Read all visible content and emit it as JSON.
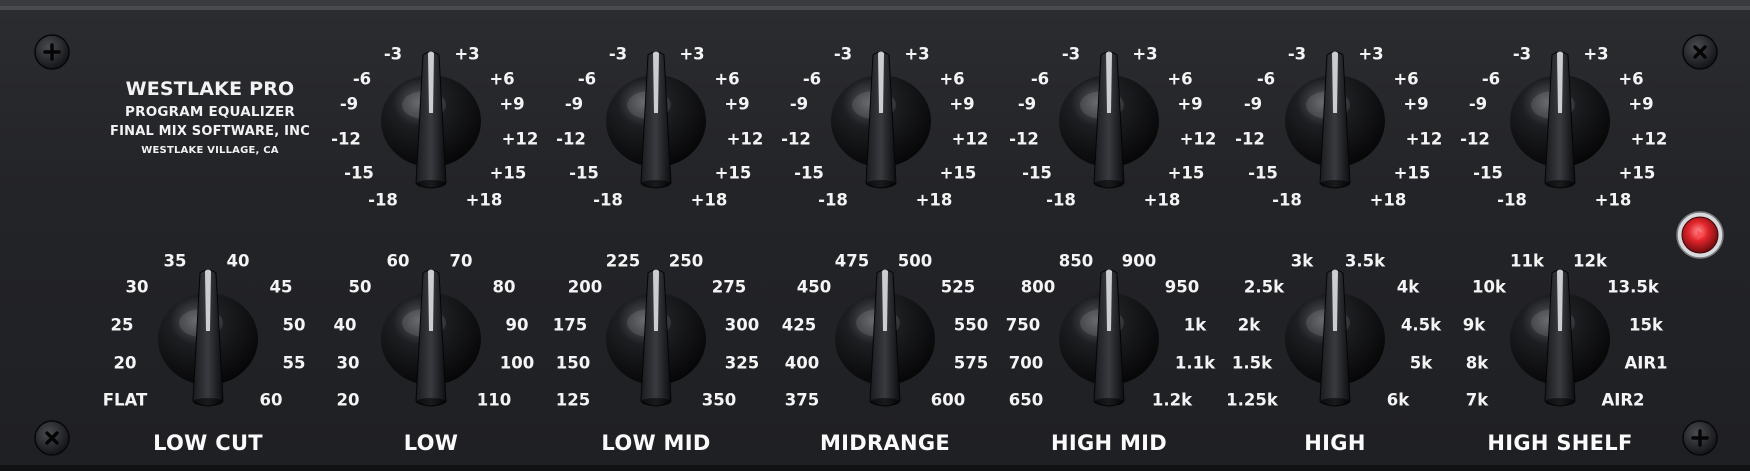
{
  "brand": {
    "line1": "WESTLAKE PRO",
    "line2": "PROGRAM EQUALIZER",
    "line3": "FINAL MIX SOFTWARE, INC",
    "line4": "WESTLAKE VILLAGE, CA"
  },
  "gain_knobs": [
    {
      "id": "gain-low-cut",
      "ticks": [
        "-18",
        "-15",
        "-12",
        "-9",
        "-6",
        "-3",
        "+3",
        "+6",
        "+9",
        "+12",
        "+15",
        "+18"
      ],
      "value": "0"
    },
    {
      "id": "gain-low",
      "ticks": [
        "-18",
        "-15",
        "-12",
        "-9",
        "-6",
        "-3",
        "+3",
        "+6",
        "+9",
        "+12",
        "+15",
        "+18"
      ],
      "value": "0"
    },
    {
      "id": "gain-low-mid",
      "ticks": [
        "-18",
        "-15",
        "-12",
        "-9",
        "-6",
        "-3",
        "+3",
        "+6",
        "+9",
        "+12",
        "+15",
        "+18"
      ],
      "value": "0"
    },
    {
      "id": "gain-midrange",
      "ticks": [
        "-18",
        "-15",
        "-12",
        "-9",
        "-6",
        "-3",
        "+3",
        "+6",
        "+9",
        "+12",
        "+15",
        "+18"
      ],
      "value": "0"
    },
    {
      "id": "gain-high-mid",
      "ticks": [
        "-18",
        "-15",
        "-12",
        "-9",
        "-6",
        "-3",
        "+3",
        "+6",
        "+9",
        "+12",
        "+15",
        "+18"
      ],
      "value": "0"
    },
    {
      "id": "gain-high",
      "ticks": [
        "-18",
        "-15",
        "-12",
        "-9",
        "-6",
        "-3",
        "+3",
        "+6",
        "+9",
        "+12",
        "+15",
        "+18"
      ],
      "value": "0"
    }
  ],
  "freq_knobs": [
    {
      "id": "freq-low-cut",
      "label": "LOW CUT",
      "ticks": [
        "FLAT",
        "20",
        "25",
        "30",
        "35",
        "40",
        "45",
        "50",
        "55",
        "60"
      ]
    },
    {
      "id": "freq-low",
      "label": "LOW",
      "ticks": [
        "20",
        "30",
        "40",
        "50",
        "60",
        "70",
        "80",
        "90",
        "100",
        "110"
      ]
    },
    {
      "id": "freq-low-mid",
      "label": "LOW MID",
      "ticks": [
        "125",
        "150",
        "175",
        "200",
        "225",
        "250",
        "275",
        "300",
        "325",
        "350"
      ]
    },
    {
      "id": "freq-midrange",
      "label": "MIDRANGE",
      "ticks": [
        "375",
        "400",
        "425",
        "450",
        "475",
        "500",
        "525",
        "550",
        "575",
        "600"
      ]
    },
    {
      "id": "freq-high-mid",
      "label": "HIGH MID",
      "ticks": [
        "650",
        "700",
        "750",
        "800",
        "850",
        "900",
        "950",
        "1k",
        "1.1k",
        "1.2k"
      ]
    },
    {
      "id": "freq-high",
      "label": "HIGH",
      "ticks": [
        "1.25k",
        "1.5k",
        "2k",
        "2.5k",
        "3k",
        "3.5k",
        "4k",
        "4.5k",
        "5k",
        "6k"
      ]
    },
    {
      "id": "freq-high-shelf",
      "label": "HIGH SHELF",
      "ticks": [
        "7k",
        "8k",
        "9k",
        "10k",
        "11k",
        "12k",
        "13.5k",
        "15k",
        "AIR1",
        "AIR2"
      ]
    }
  ],
  "power_led": {
    "state": "on",
    "color": "#e0242a"
  },
  "colors": {
    "panel": "#232428",
    "text": "#f2f2f2",
    "led": "#e0242a"
  }
}
